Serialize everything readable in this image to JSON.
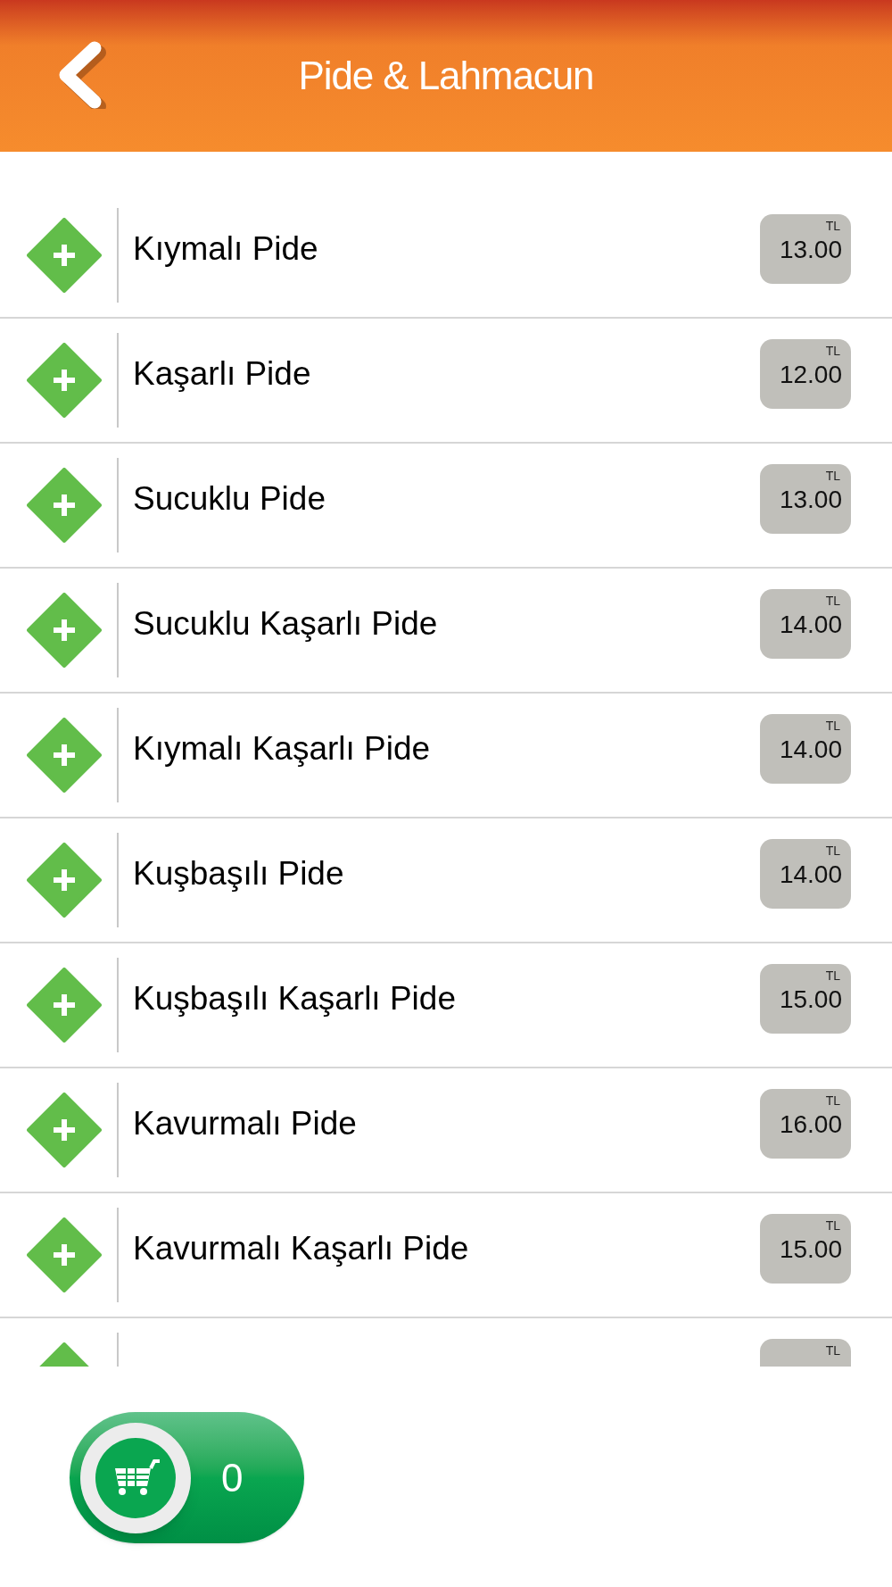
{
  "header": {
    "title": "Pide & Lahmacun"
  },
  "items": [
    {
      "name": "Kıymalı Pide",
      "currency": "TL",
      "price": "13.00"
    },
    {
      "name": "Kaşarlı Pide",
      "currency": "TL",
      "price": "12.00"
    },
    {
      "name": "Sucuklu Pide",
      "currency": "TL",
      "price": "13.00"
    },
    {
      "name": "Sucuklu Kaşarlı Pide",
      "currency": "TL",
      "price": "14.00"
    },
    {
      "name": "Kıymalı Kaşarlı Pide",
      "currency": "TL",
      "price": "14.00"
    },
    {
      "name": "Kuşbaşılı Pide",
      "currency": "TL",
      "price": "14.00"
    },
    {
      "name": "Kuşbaşılı Kaşarlı Pide",
      "currency": "TL",
      "price": "15.00"
    },
    {
      "name": "Kavurmalı Pide",
      "currency": "TL",
      "price": "16.00"
    },
    {
      "name": "Kavurmalı Kaşarlı Pide",
      "currency": "TL",
      "price": "15.00"
    },
    {
      "currency": "TL"
    }
  ],
  "cart": {
    "count": "0"
  }
}
